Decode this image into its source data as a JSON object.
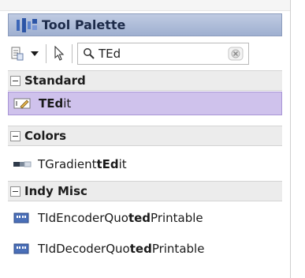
{
  "palette": {
    "title": "Tool Palette"
  },
  "toolbar": {
    "search_value": "TEd"
  },
  "groups": [
    {
      "label": "Standard",
      "items": [
        {
          "pre": "",
          "match": "TEd",
          "post": "it"
        }
      ]
    },
    {
      "label": "Colors",
      "items": [
        {
          "pre": "TGradient",
          "match": "tEd",
          "post": "it"
        }
      ]
    },
    {
      "label": "Indy Misc",
      "items": [
        {
          "pre": "TIdEncoderQuo",
          "match": "ted",
          "post": "Printable"
        },
        {
          "pre": "TIdDecoderQuo",
          "match": "ted",
          "post": "Printable"
        }
      ]
    }
  ],
  "colors": {
    "selection": "#cfc2ec",
    "header_bg": "#ececec",
    "title_gradient_top": "#bfcbe2"
  },
  "icons": {
    "title": "tool-palette-icon",
    "categories": "categories-icon",
    "dropdown": "chevron-down-icon",
    "pointer": "pointer-icon",
    "search": "search-icon",
    "clear": "clear-search-icon",
    "collapse": "collapse-minus-icon",
    "edit": "tedit-component-icon",
    "gradient": "gradient-edit-component-icon",
    "quoted": "quoted-printable-component-icon"
  }
}
